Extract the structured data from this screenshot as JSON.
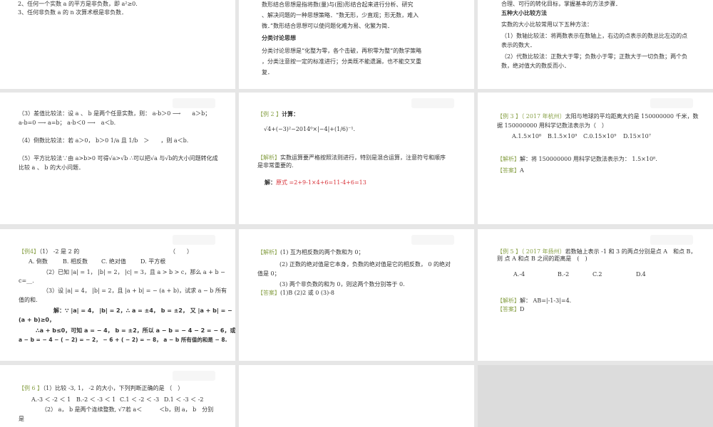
{
  "slides": [
    {
      "lines": [
        "2、任何一个实数 a 的平方是非负数，即 a²≥0.",
        "3、任何非负数 a 的 n 次算术根是非负数．"
      ]
    },
    {
      "lines": [
        "数形结合思想是指将数(量)与(图)形结合起来进行分析、研究",
        "、解决问题的一种思想策略．“数无形，少直观；形无数，难入",
        "微．”数形结合思想可以使问题化难为易、化繁为简．",
        "分类讨论思想",
        "分类讨论思想是“化整为零，各个击破，再积零为整”的数学策略",
        "，分类注意按一定的标准进行；分类既不能遗漏，也不能交叉重",
        "复．"
      ]
    },
    {
      "lines": [
        "合理、可行的转化目标，掌握基本的方法步骤．",
        "五种大小比较方法",
        "实数的大小比较常用以下五种方法：",
        "（1）数轴比较法：将两数表示在数轴上，右边的点表示的数总比左边的点",
        "表示的数大．",
        "（2）代数比较法：正数大于零；负数小于零；正数大于一切负数；两个负",
        "数，绝对值大的数反而小．"
      ]
    },
    {
      "lines": [
        "（3）差值比较法：设 a 、 b 是两个任意实数，则： a-b＞0 ⟶　　a＞b；",
        "a-b=0 ⟶ a=b； a-b＜0 ⟶　a＜b.",
        "（4）倒数比较法：若 a＞0， b＞0 1/a 且 1/b　＞　　，则 a＜b.",
        "（5）平方比较法∵由 a>b>0 可得√a>√b ∴可以把√a 与√b的大小问题转化成",
        "比较 a 、 b 的大小问题．"
      ]
    },
    {
      "tag": "【例 2 】",
      "lines": [
        "计算：",
        "√4+(−3)²−2014⁰×|−4|+(1/6)⁻¹.",
        "【解析】",
        "实数运算要严格按照法则进行，特别是混合运算，注意符号和顺序",
        "是非常重要的.",
        "解：",
        "原式 =2+9-1×4+6=11-4+6=13"
      ]
    },
    {
      "tag": "【例 3 】",
      "lines": [
        "（ 2017 年杭州）",
        "太阳与地球的平均距离大约是 150000000 千米，数",
        "据 150000000 用科学记数法表示为（　）",
        "A.1.5×10⁸",
        "B.1.5×10⁹",
        "C.0.15×10⁹",
        "D.15×10⁷",
        "【解析】",
        "解：将 150000000 用科学记数法表示为： 1.5×10⁸.",
        "【答案】",
        "A"
      ]
    },
    {
      "tag": "【例4】",
      "lines": [
        "（1） -2 是 2 的",
        "（　　）",
        "A. 倒数",
        "B. 相反数",
        "C. 绝对值",
        "D. 平方根",
        "（2）已知 |a| = 1， |b| = 2， |c| = 3，且 a > b > c，那么 a + b −",
        "c=__.",
        "（3）设 |a| = 4， |b| = 2，且 |a + b| = − (a + b)，试求 a − b 所有",
        "值的和.",
        "解：∵ |a| = 4， |b| = 2，∴ a = ±4， b = ±2， 又 |a + b| = −",
        "(a + b)≥0，",
        "∴a + b≤0，可知 a = − 4， b = ±2，所以 a − b = − 4 − 2 = − 6，或",
        "a − b = − 4 − ( − 2) = − 2， − 6 + ( − 2) = − 8， a − b 所有值的和是 − 8."
      ]
    },
    {
      "lines": [
        "【解析】",
        "(1) 互为相反数的两个数和为 0；",
        "(2) 正数的绝对值是它本身，负数的绝对值是它的相反数， 0 的绝对",
        "值是 0；",
        "(3) 两个非负数的和为 0，则这两个数分别等于 0.",
        "【答案】",
        "(1)B (2)2 或 0 (3)-8"
      ]
    },
    {
      "tag": "【例 5 】",
      "lines": [
        "（ 2017 年扬州）",
        "若数轴上表示 -1 和 3 的两点分别是点 A　和点 B，",
        "则 点 A 和点 B 之间的距离是　(　)",
        "A.-4",
        "B.-2",
        "C.2",
        "D.4",
        "【解析】",
        "解： AB=|-1-3|=4.",
        "【答案】",
        "D"
      ]
    },
    {
      "tag": "【例 6 】",
      "lines": [
        "（1）比较 -3, 1， -2 的大小，下列判断正确的是 （　）",
        "A.-3 ＜ -2 ＜ 1",
        "B.-2 ＜ -3 ＜ 1",
        "C.1 ＜ -2 ＜ -3",
        "D.1 ＜ -3 ＜ -2",
        "（2） a， b 是两个连续整数, √7若 a＜　　　＜b，则 a， b　分别",
        "是"
      ]
    },
    {
      "lines": []
    }
  ],
  "colors": {
    "tag": "#8aa24a",
    "answer": "#d8333a",
    "background": "#e6e6e6"
  }
}
